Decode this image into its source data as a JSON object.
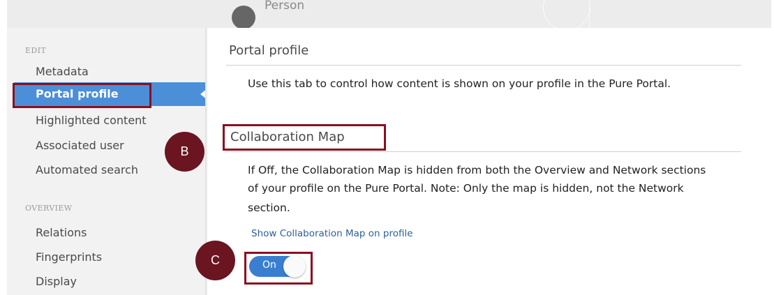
{
  "header": {
    "label": "Person"
  },
  "sidebar": {
    "sections": [
      {
        "heading": "EDIT",
        "items": [
          "Metadata",
          "Portal profile",
          "Highlighted content",
          "Associated user",
          "Automated search"
        ]
      },
      {
        "heading": "OVERVIEW",
        "items": [
          "Relations",
          "Fingerprints",
          "Display"
        ]
      }
    ],
    "active_item": "Portal profile"
  },
  "main": {
    "portal_profile": {
      "title": "Portal profile",
      "description": "Use this tab to control how content is shown on your profile in the Pure Portal."
    },
    "collaboration_map": {
      "title": "Collaboration Map",
      "description_line1": "If Off, the Collaboration Map is hidden from both the Overview and Network sections",
      "description_line2": "of your profile on the Pure Portal. Note: Only the map is hidden, not the Network",
      "description_line3": "section.",
      "toggle_label": "Show Collaboration Map on profile",
      "toggle_state": "On"
    }
  },
  "annotations": {
    "marker_b": "B",
    "marker_c": "C"
  },
  "colors": {
    "active_item_bg": "#4b8fd8",
    "highlight_border": "#8a0f1f",
    "marker_bg": "#6a1520",
    "toggle_on": "#3a7fcf",
    "link": "#2e5f9b"
  }
}
